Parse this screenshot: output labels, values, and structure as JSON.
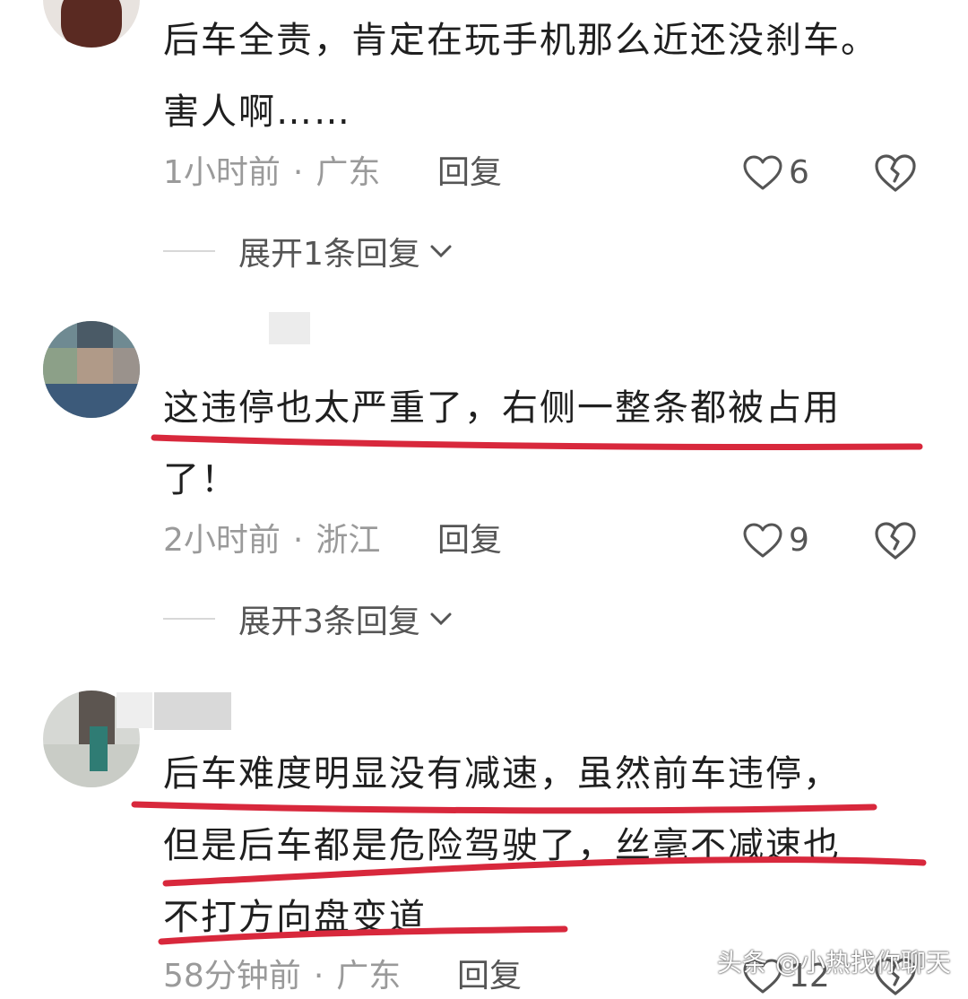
{
  "comments": [
    {
      "lines": [
        "后车全责，肯定在玩手机那么近还没刹车。",
        "害人啊……"
      ],
      "time": "1小时前",
      "location": "广东",
      "reply_label": "回复",
      "likes": "6",
      "expand_label": "展开1条回复"
    },
    {
      "lines": [
        "这违停也太严重了，右侧一整条都被占用",
        "了！"
      ],
      "time": "2小时前",
      "location": "浙江",
      "reply_label": "回复",
      "likes": "9",
      "expand_label": "展开3条回复"
    },
    {
      "lines": [
        "后车难度明显没有减速，虽然前车违停，",
        "但是后车都是危险驾驶了，丝毫不减速也",
        "不打方向盘变道"
      ],
      "time": "58分钟前",
      "location": "广东",
      "reply_label": "回复",
      "likes": "12"
    }
  ],
  "separator": "·",
  "watermark": "头条 @小热找你聊天",
  "colors": {
    "annotation_red": "#d8283c",
    "meta_gray": "#9a9a9a",
    "text": "#1f1f1f"
  },
  "icons": [
    "heart-outline-icon",
    "broken-heart-icon",
    "chevron-down-icon"
  ]
}
